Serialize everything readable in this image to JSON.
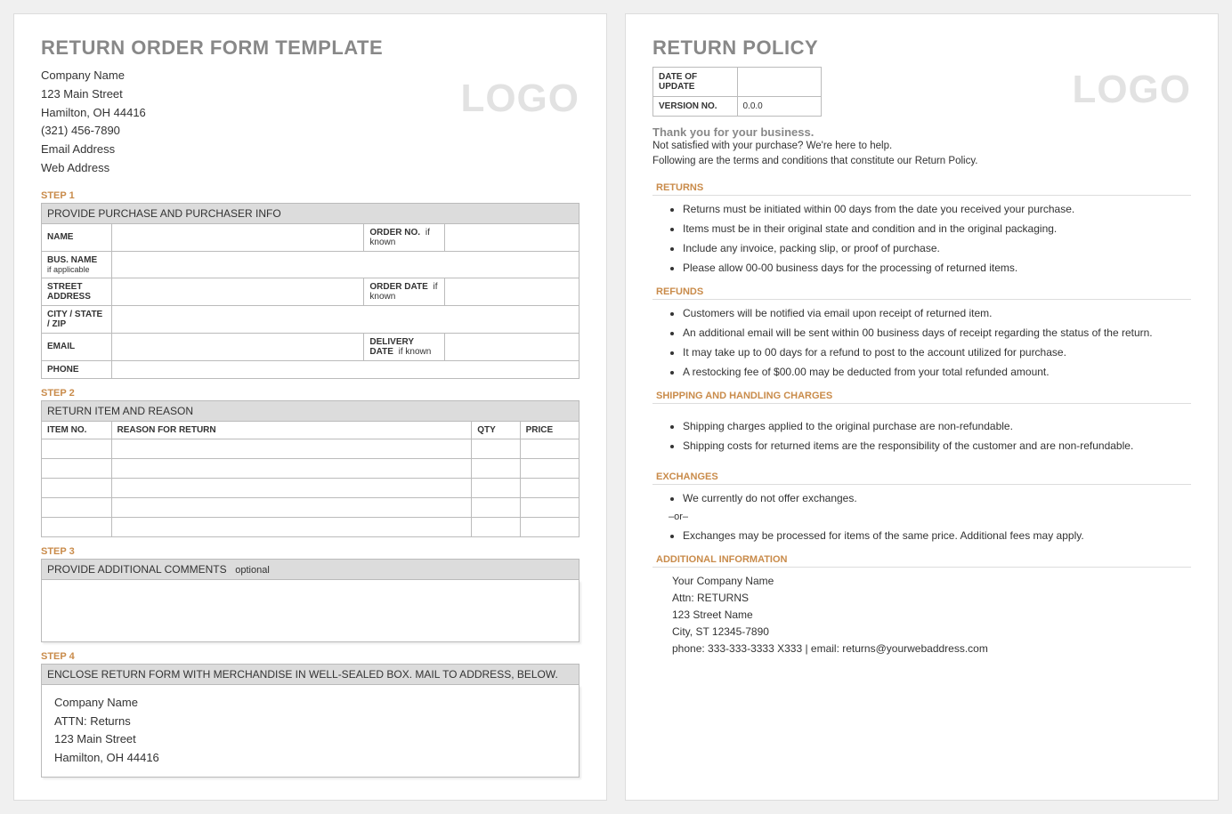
{
  "left": {
    "title": "RETURN ORDER FORM TEMPLATE",
    "logo": "LOGO",
    "company": {
      "name": "Company Name",
      "street": "123 Main Street",
      "city": "Hamilton, OH 44416",
      "phone": "(321) 456-7890",
      "email": "Email Address",
      "web": "Web Address"
    },
    "step1": {
      "label": "STEP 1",
      "header": "PROVIDE PURCHASE AND PURCHASER INFO",
      "fields": {
        "name": "NAME",
        "busname": "BUS. NAME",
        "busname_sub": "if applicable",
        "orderno": "ORDER NO.",
        "orderno_note": "if known",
        "street": "STREET ADDRESS",
        "orderdate": "ORDER DATE",
        "orderdate_note": "if known",
        "csz": "CITY / STATE / ZIP",
        "email": "EMAIL",
        "delivdate": "DELIVERY DATE",
        "delivdate_note": "if known",
        "phone": "PHONE"
      }
    },
    "step2": {
      "label": "STEP 2",
      "header": "RETURN ITEM AND REASON",
      "cols": {
        "item": "ITEM NO.",
        "reason": "REASON FOR RETURN",
        "qty": "QTY",
        "price": "PRICE"
      }
    },
    "step3": {
      "label": "STEP 3",
      "header": "PROVIDE ADDITIONAL COMMENTS",
      "note": "optional"
    },
    "step4": {
      "label": "STEP 4",
      "header": "ENCLOSE RETURN FORM WITH MERCHANDISE IN WELL-SEALED BOX.  MAIL TO ADDRESS, BELOW.",
      "addr": {
        "name": "Company Name",
        "attn": "ATTN: Returns",
        "street": "123 Main Street",
        "city": "Hamilton, OH 44416"
      }
    }
  },
  "right": {
    "title": "RETURN POLICY",
    "logo": "LOGO",
    "meta": {
      "date_lbl": "DATE OF UPDATE",
      "date_val": "",
      "ver_lbl": "VERSION NO.",
      "ver_val": "0.0.0"
    },
    "thanks": "Thank you for your business.",
    "intro1": "Not satisfied with your purchase? We're here to help.",
    "intro2": "Following are the terms and conditions that constitute our Return Policy.",
    "sections": {
      "returns": {
        "hdr": "RETURNS",
        "items": [
          "Returns must be initiated within 00 days from the date you received your purchase.",
          "Items must be in their original state and condition and in the original packaging.",
          "Include any invoice, packing slip, or proof of purchase.",
          "Please allow 00-00 business days for the processing of returned items."
        ]
      },
      "refunds": {
        "hdr": "REFUNDS",
        "items": [
          "Customers will be notified via email upon receipt of returned item.",
          "An additional email will be sent within 00 business days of receipt regarding the status of the return.",
          "It may take up to 00 days for a refund to post to the account utilized for purchase.",
          "A restocking fee of $00.00 may be deducted from your total refunded amount."
        ]
      },
      "shipping": {
        "hdr": "SHIPPING AND HANDLING CHARGES",
        "items": [
          "Shipping charges applied to the original purchase are non-refundable.",
          "Shipping costs for returned items are the responsibility of the customer and are non-refundable."
        ]
      },
      "exchanges": {
        "hdr": "EXCHANGES",
        "item1": "We currently do not offer exchanges.",
        "or": "–or–",
        "item2": "Exchanges may be processed for items of the same price. Additional fees may apply."
      },
      "additional": {
        "hdr": "ADDITIONAL INFORMATION",
        "name": "Your Company Name",
        "attn": "Attn: RETURNS",
        "street": "123 Street Name",
        "city": "City, ST  12345-7890",
        "contact": "phone: 333-333-3333 X333    |    email: returns@yourwebaddress.com"
      }
    }
  }
}
